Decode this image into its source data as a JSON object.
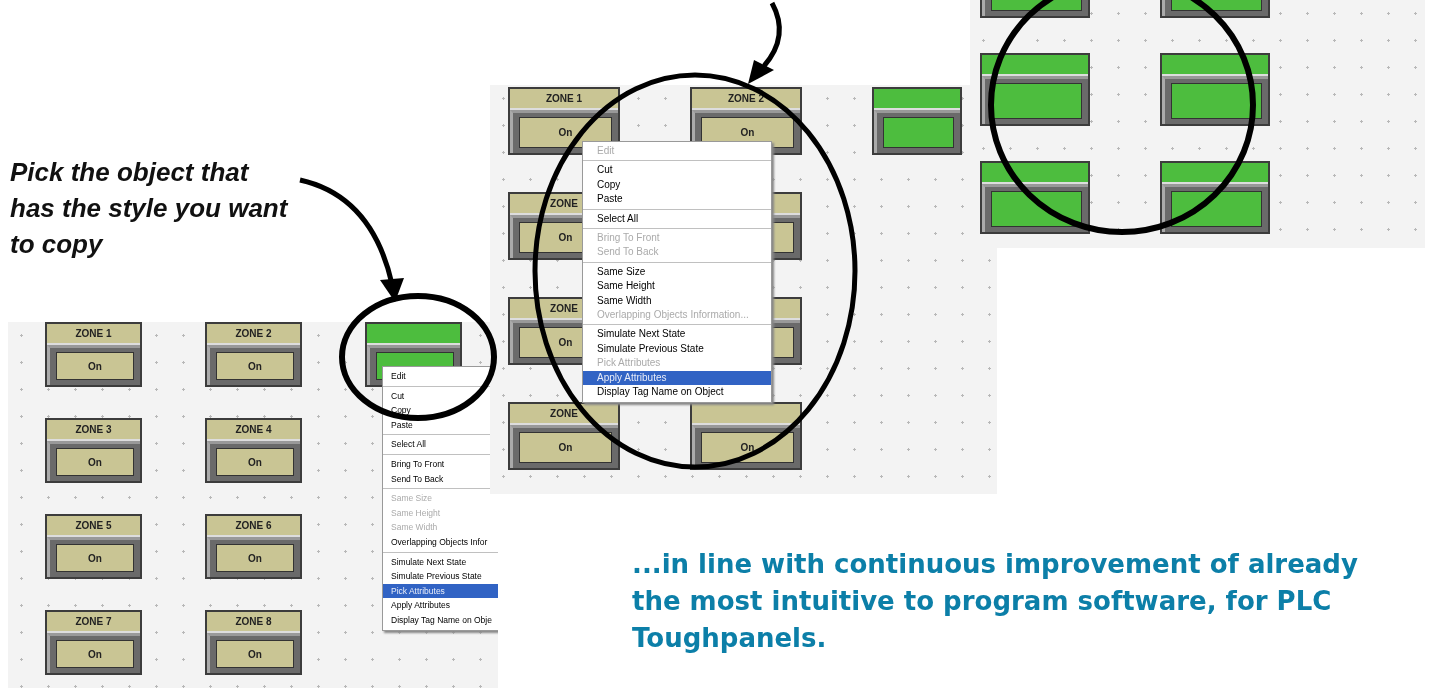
{
  "caption": "Pick the object that has the style you want to copy",
  "panel_left": {
    "rows": [
      [
        {
          "kind": "tan",
          "title": "ZONE 1",
          "value": "On"
        },
        {
          "kind": "tan",
          "title": "ZONE 2",
          "value": "On"
        },
        {
          "kind": "green"
        }
      ],
      [
        {
          "kind": "tan",
          "title": "ZONE 3",
          "value": "On"
        },
        {
          "kind": "tan",
          "title": "ZONE 4",
          "value": "On"
        }
      ],
      [
        {
          "kind": "tan",
          "title": "ZONE 5",
          "value": "On"
        },
        {
          "kind": "tan",
          "title": "ZONE 6",
          "value": "On"
        }
      ],
      [
        {
          "kind": "tan",
          "title": "ZONE 7",
          "value": "On"
        },
        {
          "kind": "tan",
          "title": "ZONE 8",
          "value": "On"
        }
      ]
    ],
    "menu": {
      "items": [
        {
          "label": "Edit",
          "disabled": false,
          "selected": false,
          "separator_before": false
        },
        {
          "label": "Cut",
          "disabled": false,
          "selected": false,
          "separator_before": true
        },
        {
          "label": "Copy",
          "disabled": false,
          "selected": false,
          "separator_before": false
        },
        {
          "label": "Paste",
          "disabled": false,
          "selected": false,
          "separator_before": false
        },
        {
          "label": "Select All",
          "disabled": false,
          "selected": false,
          "separator_before": true
        },
        {
          "label": "Bring To Front",
          "disabled": false,
          "selected": false,
          "separator_before": true
        },
        {
          "label": "Send To Back",
          "disabled": false,
          "selected": false,
          "separator_before": false
        },
        {
          "label": "Same Size",
          "disabled": true,
          "selected": false,
          "separator_before": true
        },
        {
          "label": "Same Height",
          "disabled": true,
          "selected": false,
          "separator_before": false
        },
        {
          "label": "Same Width",
          "disabled": true,
          "selected": false,
          "separator_before": false
        },
        {
          "label": "Overlapping Objects Infor",
          "disabled": false,
          "selected": false,
          "separator_before": false
        },
        {
          "label": "Simulate Next State",
          "disabled": false,
          "selected": false,
          "separator_before": true
        },
        {
          "label": "Simulate Previous State",
          "disabled": false,
          "selected": false,
          "separator_before": false
        },
        {
          "label": "Pick Attributes",
          "disabled": false,
          "selected": true,
          "separator_before": false
        },
        {
          "label": "Apply Attributes",
          "disabled": false,
          "selected": false,
          "separator_before": false
        },
        {
          "label": "Display Tag Name on Obje",
          "disabled": false,
          "selected": false,
          "separator_before": false
        }
      ]
    }
  },
  "panel_middle": {
    "rows": [
      [
        {
          "kind": "tan",
          "title": "ZONE 1",
          "value": "On"
        },
        {
          "kind": "tan",
          "title": "ZONE 2",
          "value": "On"
        },
        {
          "kind": "green"
        }
      ],
      [
        {
          "kind": "tan",
          "title": "ZONE",
          "value": "On"
        },
        {
          "kind": "tan"
        }
      ],
      [
        {
          "kind": "tan",
          "title": "ZONE",
          "value": "On"
        },
        {
          "kind": "tan"
        }
      ],
      [
        {
          "kind": "tan",
          "title": "ZONE",
          "value": "On"
        },
        {
          "kind": "tan",
          "value": "On"
        }
      ]
    ],
    "menu": {
      "items": [
        {
          "label": "Edit",
          "disabled": true,
          "selected": false,
          "separator_before": false
        },
        {
          "label": "Cut",
          "disabled": false,
          "selected": false,
          "separator_before": true
        },
        {
          "label": "Copy",
          "disabled": false,
          "selected": false,
          "separator_before": false
        },
        {
          "label": "Paste",
          "disabled": false,
          "selected": false,
          "separator_before": false
        },
        {
          "label": "Select All",
          "disabled": false,
          "selected": false,
          "separator_before": true
        },
        {
          "label": "Bring To Front",
          "disabled": true,
          "selected": false,
          "separator_before": true
        },
        {
          "label": "Send To Back",
          "disabled": true,
          "selected": false,
          "separator_before": false
        },
        {
          "label": "Same Size",
          "disabled": false,
          "selected": false,
          "separator_before": true
        },
        {
          "label": "Same Height",
          "disabled": false,
          "selected": false,
          "separator_before": false
        },
        {
          "label": "Same Width",
          "disabled": false,
          "selected": false,
          "separator_before": false
        },
        {
          "label": "Overlapping Objects Information...",
          "disabled": true,
          "selected": false,
          "separator_before": false
        },
        {
          "label": "Simulate Next State",
          "disabled": false,
          "selected": false,
          "separator_before": true
        },
        {
          "label": "Simulate Previous State",
          "disabled": false,
          "selected": false,
          "separator_before": false
        },
        {
          "label": "Pick Attributes",
          "disabled": true,
          "selected": false,
          "separator_before": false
        },
        {
          "label": "Apply Attributes",
          "disabled": false,
          "selected": true,
          "separator_before": false
        },
        {
          "label": "Display Tag Name on Object",
          "disabled": false,
          "selected": false,
          "separator_before": false
        }
      ]
    }
  },
  "panel_right": {
    "rows": [
      [
        {
          "kind": "green"
        },
        {
          "kind": "green"
        }
      ],
      [
        {
          "kind": "green"
        },
        {
          "kind": "green"
        }
      ],
      [
        {
          "kind": "green"
        },
        {
          "kind": "green"
        }
      ]
    ]
  },
  "tagline": "...in line with continuous improvement of already the most intuitive to program software, for PLC Toughpanels."
}
